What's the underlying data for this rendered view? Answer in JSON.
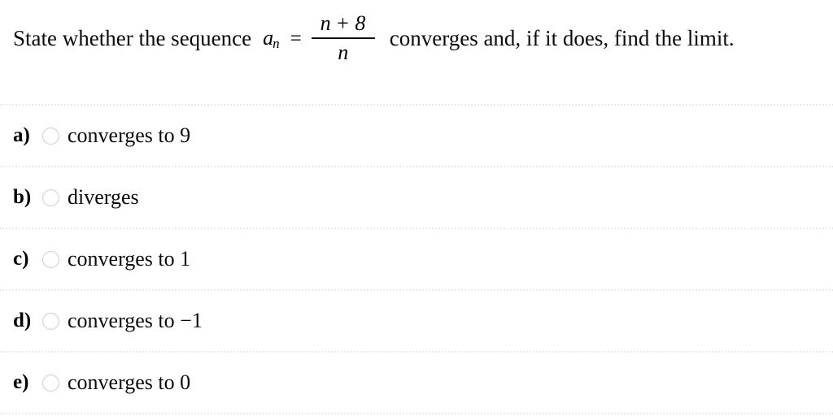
{
  "question": {
    "lead_text": "State whether the sequence",
    "trailing_text": "converges and, if it does, find the limit.",
    "formula": {
      "variable": "a",
      "subscript": "n",
      "equals": "=",
      "numerator_left": "n",
      "numerator_operator": "+",
      "numerator_right": "8",
      "denominator": "n",
      "plain": "a_n = (n + 8) / n"
    }
  },
  "options": [
    {
      "letter": "a)",
      "label": "converges to 9",
      "selected": false
    },
    {
      "letter": "b)",
      "label": "diverges",
      "selected": false
    },
    {
      "letter": "c)",
      "label": "converges to 1",
      "selected": false
    },
    {
      "letter": "d)",
      "label": "converges to −1",
      "selected": false
    },
    {
      "letter": "e)",
      "label": "converges to 0",
      "selected": false
    }
  ],
  "colors": {
    "background": "#ffffff",
    "text": "#0b0b0b",
    "divider": "#eceaea",
    "radio_border": "#cfcfcf"
  }
}
